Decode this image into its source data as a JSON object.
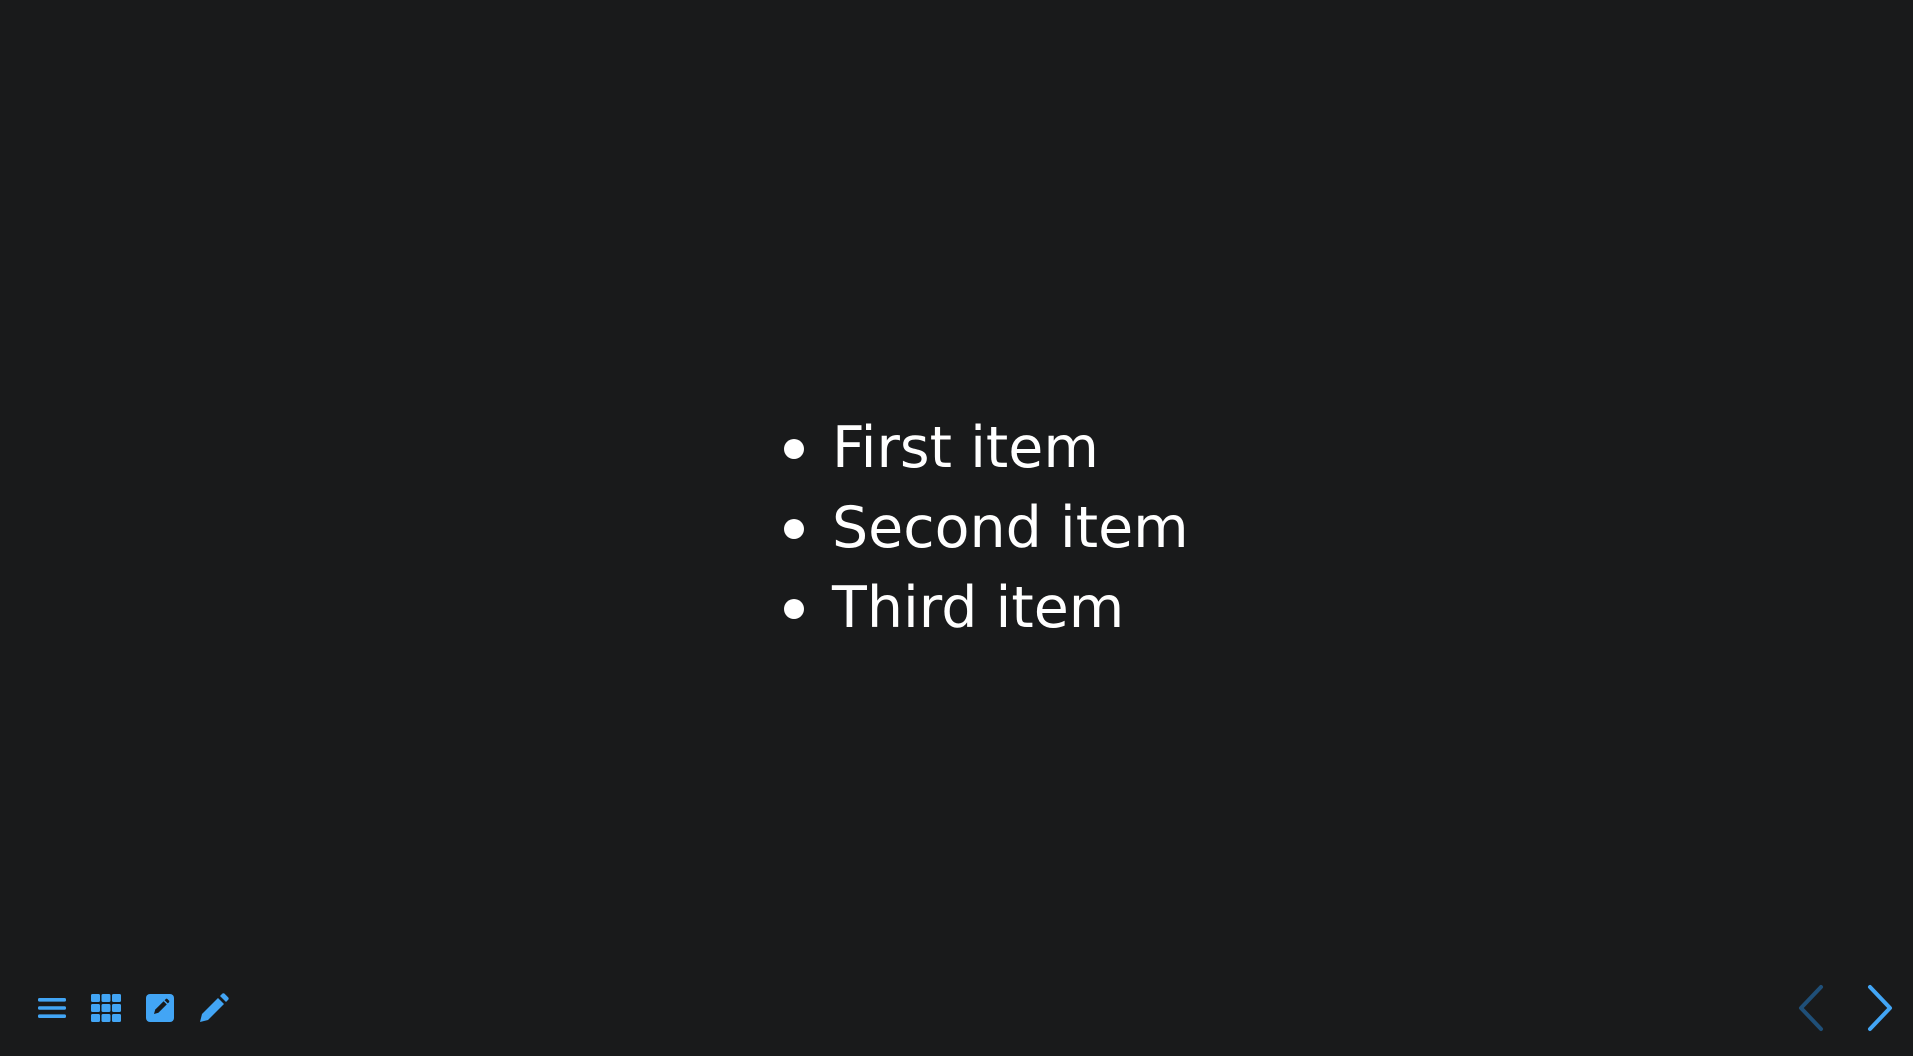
{
  "slide": {
    "items": [
      {
        "label": "First item"
      },
      {
        "label": "Second item"
      },
      {
        "label": "Third item"
      }
    ]
  },
  "toolbar": {
    "buttons": [
      {
        "icon": "hamburger-menu-icon"
      },
      {
        "icon": "grid-icon"
      },
      {
        "icon": "edit-square-icon"
      },
      {
        "icon": "pencil-icon"
      }
    ]
  },
  "navigation": {
    "prev": {
      "icon": "chevron-left-icon",
      "enabled": false
    },
    "next": {
      "icon": "chevron-right-icon",
      "enabled": true
    }
  },
  "colors": {
    "background": "#191a1b",
    "text": "#ffffff",
    "accent": "#42a5f5",
    "accent_disabled": "#1f4f78"
  }
}
